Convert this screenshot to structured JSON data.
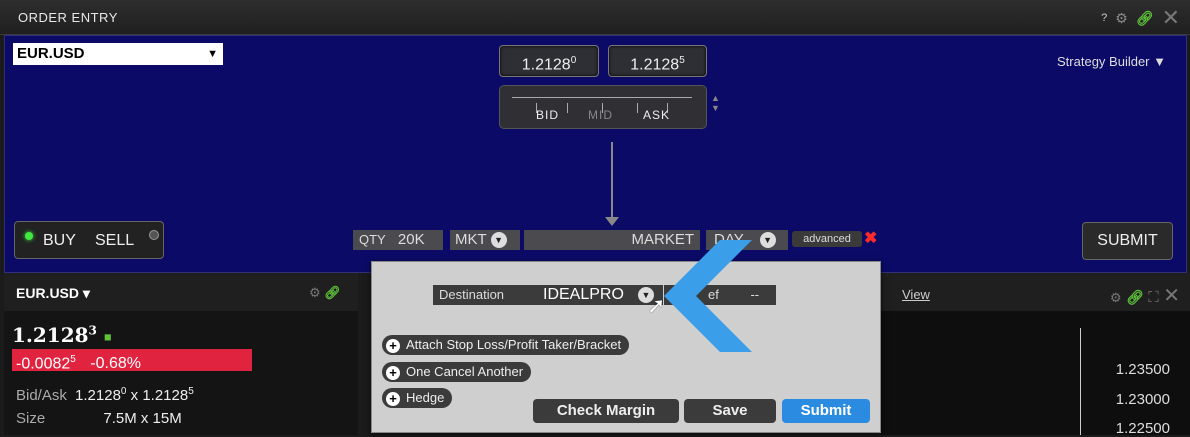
{
  "window": {
    "title": "ORDER ENTRY"
  },
  "title_icons": {
    "help": "?",
    "settings": "gear-icon",
    "link": "link-icon",
    "close": "close-icon"
  },
  "order": {
    "symbol": "EUR.USD",
    "bid_main": "1.2128",
    "bid_sup": "0",
    "ask_main": "1.2128",
    "ask_sup": "5",
    "slider_bid": "BID",
    "slider_mid": "MID",
    "slider_ask": "ASK",
    "strategy_builder": "Strategy Builder ▼",
    "buy": "BUY",
    "sell": "SELL",
    "qty_label": "QTY",
    "qty_value": "20K",
    "order_type": "MKT",
    "price_text": "MARKET",
    "tif": "DAY",
    "advanced": "advanced",
    "submit": "SUBMIT"
  },
  "quote": {
    "symbol": "EUR.USD ▾",
    "last_main": "1.2128",
    "last_sup": "3",
    "change_main": "-0.0082",
    "change_sup": "5",
    "change_pct": "-0.68%",
    "bidask_label": "Bid/Ask",
    "bidask_bid": "1.2128",
    "bidask_bid_sup": "0",
    "bidask_x": "x",
    "bidask_ask": "1.2128",
    "bidask_ask_sup": "5",
    "size_label": "Size",
    "size_value": "7.5M x 15M"
  },
  "chart": {
    "view": "View",
    "y_labels": [
      "1.23500",
      "1.23000",
      "1.22500"
    ]
  },
  "advanced_panel": {
    "destination_label": "Destination",
    "destination_value": "IDEALPRO",
    "ref_label": "ef",
    "ref_value": "--",
    "attach_label": "Attach Stop Loss/Profit Taker/Bracket",
    "oca_label": "One Cancel Another",
    "hedge_label": "Hedge",
    "check_margin": "Check Margin",
    "save": "Save",
    "submit": "Submit"
  },
  "colors": {
    "panel_bg": "#0b0a66",
    "down_red": "#e02440",
    "link_green": "#5ec33b",
    "submit_blue": "#2a8be0",
    "chevron_blue": "#3a9ee8"
  }
}
